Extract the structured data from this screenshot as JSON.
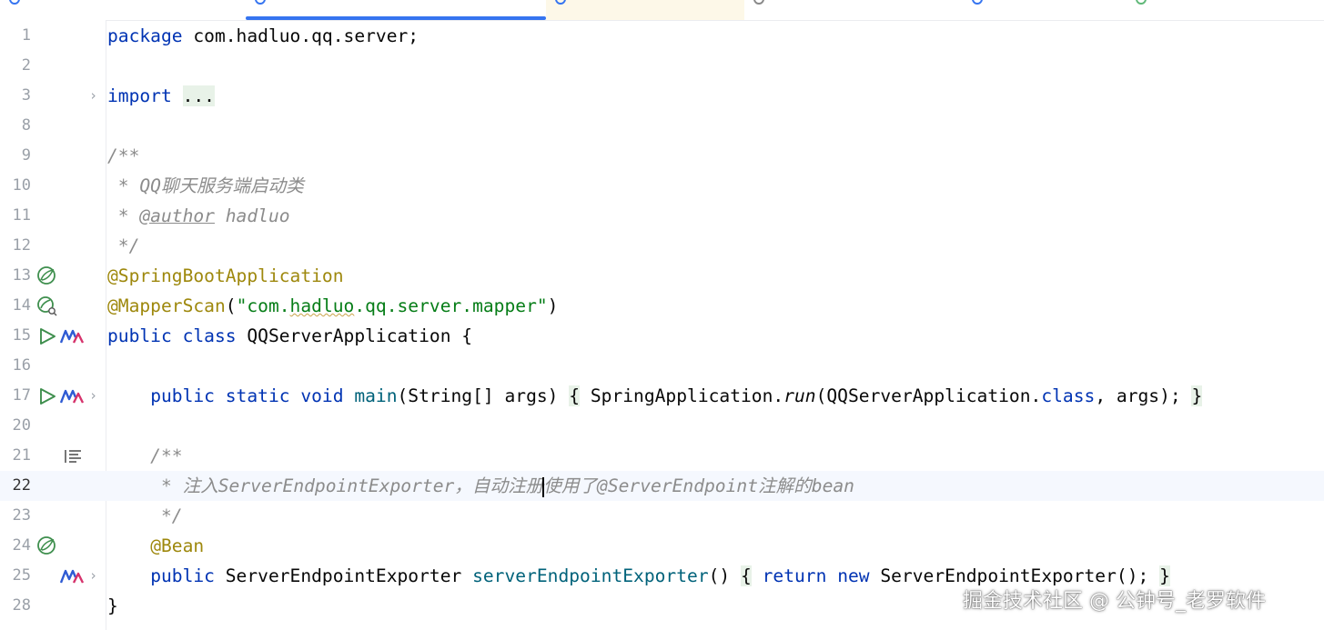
{
  "editor": {
    "lines": [
      {
        "num": "1",
        "tokens": [
          {
            "t": "package",
            "c": "kw"
          },
          {
            "t": " com.hadluo.qq.server;",
            "c": ""
          }
        ]
      },
      {
        "num": "2",
        "tokens": []
      },
      {
        "num": "3",
        "fold": true,
        "tokens": [
          {
            "t": "import",
            "c": "kw"
          },
          {
            "t": " ",
            "c": ""
          },
          {
            "t": "...",
            "c": "fold-hl"
          }
        ]
      },
      {
        "num": "8",
        "tokens": []
      },
      {
        "num": "9",
        "tokens": [
          {
            "t": "/**",
            "c": "cmt"
          }
        ]
      },
      {
        "num": "10",
        "tokens": [
          {
            "t": " * QQ聊天服务端启动类",
            "c": "cmt"
          }
        ]
      },
      {
        "num": "11",
        "tokens": [
          {
            "t": " * ",
            "c": "cmt"
          },
          {
            "t": "@author",
            "c": "tag"
          },
          {
            "t": " hadluo",
            "c": "cmt"
          }
        ]
      },
      {
        "num": "12",
        "tokens": [
          {
            "t": " */",
            "c": "cmt"
          }
        ]
      },
      {
        "num": "13",
        "icons": [
          "spring-bean-icon"
        ],
        "tokens": [
          {
            "t": "@SpringBootApplication",
            "c": "ann"
          }
        ]
      },
      {
        "num": "14",
        "icons": [
          "spring-scan-icon"
        ],
        "tokens": [
          {
            "t": "@MapperScan",
            "c": "ann"
          },
          {
            "t": "(",
            "c": ""
          },
          {
            "t": "\"com.",
            "c": "str"
          },
          {
            "t": "hadluo",
            "c": "str squiggle"
          },
          {
            "t": ".qq.server.mapper\"",
            "c": "str"
          },
          {
            "t": ")",
            "c": ""
          }
        ]
      },
      {
        "num": "15",
        "icons": [
          "run-icon",
          "mybatis-icon"
        ],
        "tokens": [
          {
            "t": "public",
            "c": "kw"
          },
          {
            "t": " ",
            "c": ""
          },
          {
            "t": "class",
            "c": "kw"
          },
          {
            "t": " QQServerApplication {",
            "c": ""
          }
        ]
      },
      {
        "num": "16",
        "tokens": []
      },
      {
        "num": "17",
        "icons": [
          "run-icon",
          "mybatis-icon"
        ],
        "fold": true,
        "tokens": [
          {
            "t": "    ",
            "c": ""
          },
          {
            "t": "public",
            "c": "kw"
          },
          {
            "t": " ",
            "c": ""
          },
          {
            "t": "static",
            "c": "kw"
          },
          {
            "t": " ",
            "c": ""
          },
          {
            "t": "void",
            "c": "kw"
          },
          {
            "t": " ",
            "c": ""
          },
          {
            "t": "main",
            "c": "fn"
          },
          {
            "t": "(String[] args) ",
            "c": ""
          },
          {
            "t": "{",
            "c": "fold-hl"
          },
          {
            "t": " SpringApplication.",
            "c": ""
          },
          {
            "t": "run",
            "c": "it"
          },
          {
            "t": "(QQServerApplication.",
            "c": ""
          },
          {
            "t": "class",
            "c": "kw"
          },
          {
            "t": ", args); ",
            "c": ""
          },
          {
            "t": "}",
            "c": "fold-hl"
          }
        ]
      },
      {
        "num": "20",
        "tokens": []
      },
      {
        "num": "21",
        "icons": [
          "doc-render-icon"
        ],
        "tokens": [
          {
            "t": "    /**",
            "c": "cmt"
          }
        ]
      },
      {
        "num": "22",
        "current": true,
        "tokens": [
          {
            "t": "     * 注入ServerEndpointExporter，自动注册",
            "c": "cmt"
          },
          {
            "t": "",
            "c": "caret"
          },
          {
            "t": "使用了@ServerEndpoint注解的bean",
            "c": "cmt"
          }
        ]
      },
      {
        "num": "23",
        "tokens": [
          {
            "t": "     */",
            "c": "cmt"
          }
        ]
      },
      {
        "num": "24",
        "icons": [
          "spring-bean-icon"
        ],
        "tokens": [
          {
            "t": "    ",
            "c": ""
          },
          {
            "t": "@Bean",
            "c": "ann"
          }
        ]
      },
      {
        "num": "25",
        "icons": [
          "mybatis-icon"
        ],
        "fold": true,
        "tokens": [
          {
            "t": "    ",
            "c": ""
          },
          {
            "t": "public",
            "c": "kw"
          },
          {
            "t": " ServerEndpointExporter ",
            "c": ""
          },
          {
            "t": "serverEndpointExporter",
            "c": "fn"
          },
          {
            "t": "() ",
            "c": ""
          },
          {
            "t": "{",
            "c": "fold-hl"
          },
          {
            "t": " ",
            "c": ""
          },
          {
            "t": "return",
            "c": "kw"
          },
          {
            "t": " ",
            "c": ""
          },
          {
            "t": "new",
            "c": "kw"
          },
          {
            "t": " ServerEndpointExporter(); ",
            "c": ""
          },
          {
            "t": "}",
            "c": "fold-hl"
          }
        ]
      },
      {
        "num": "28",
        "tokens": [
          {
            "t": "}",
            "c": ""
          }
        ]
      }
    ]
  },
  "watermark": "掘金技术社区 @ 公钟号_老罗软件",
  "colors": {
    "keyword": "#0033b3",
    "annotation": "#9e880d",
    "string": "#067d17",
    "comment": "#8c8c8c",
    "function": "#00627a",
    "accent": "#3574f0",
    "current_line": "#f5f8fe"
  }
}
